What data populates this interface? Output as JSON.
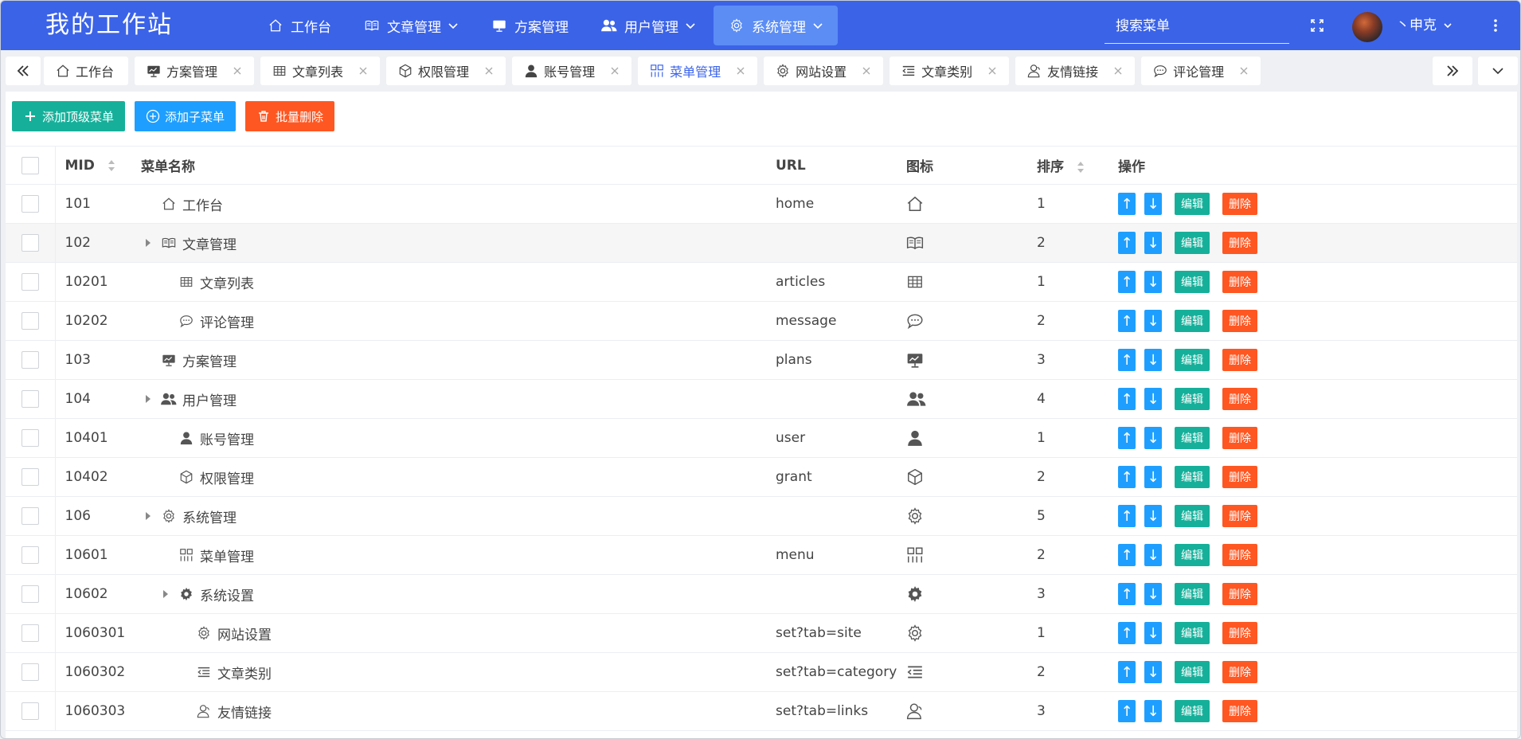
{
  "app": {
    "title": "我的工作站"
  },
  "nav": {
    "items": [
      {
        "label": "工作台",
        "icon": "home-icon",
        "dropdown": false
      },
      {
        "label": "文章管理",
        "icon": "book-icon",
        "dropdown": true
      },
      {
        "label": "方案管理",
        "icon": "presentation-icon",
        "dropdown": false
      },
      {
        "label": "用户管理",
        "icon": "users-icon",
        "dropdown": true
      },
      {
        "label": "系统管理",
        "icon": "gear-icon",
        "dropdown": true,
        "active": true
      }
    ]
  },
  "search": {
    "placeholder": "搜索菜单"
  },
  "user": {
    "name": "丶申克"
  },
  "tabs": [
    {
      "label": "工作台",
      "icon": "home-icon",
      "closable": false
    },
    {
      "label": "方案管理",
      "icon": "presentation-icon",
      "closable": true
    },
    {
      "label": "文章列表",
      "icon": "table-icon",
      "closable": true
    },
    {
      "label": "权限管理",
      "icon": "cube-icon",
      "closable": true
    },
    {
      "label": "账号管理",
      "icon": "user-icon",
      "closable": true
    },
    {
      "label": "菜单管理",
      "icon": "menu-grid-icon",
      "closable": true,
      "active": true
    },
    {
      "label": "网站设置",
      "icon": "gear-icon",
      "closable": true
    },
    {
      "label": "文章类别",
      "icon": "indent-icon",
      "closable": true
    },
    {
      "label": "友情链接",
      "icon": "user-outline-icon",
      "closable": true
    },
    {
      "label": "评论管理",
      "icon": "chat-icon",
      "closable": true
    }
  ],
  "toolbar": {
    "add_top_label": "添加顶级菜单",
    "add_child_label": "添加子菜单",
    "batch_delete_label": "批量删除"
  },
  "table": {
    "columns": {
      "mid": "MID",
      "name": "菜单名称",
      "url": "URL",
      "icon": "图标",
      "sort": "排序",
      "ops": "操作"
    },
    "op_labels": {
      "up": "↑",
      "down": "↓",
      "edit": "编辑",
      "delete": "删除"
    },
    "rows": [
      {
        "mid": "101",
        "name": "工作台",
        "url": "home",
        "icon": "home-icon",
        "sort": "1",
        "level": 0,
        "expandable": false
      },
      {
        "mid": "102",
        "name": "文章管理",
        "url": "",
        "icon": "book-icon",
        "sort": "2",
        "level": 0,
        "expandable": true
      },
      {
        "mid": "10201",
        "name": "文章列表",
        "url": "articles",
        "icon": "table-icon",
        "sort": "1",
        "level": 1,
        "expandable": false
      },
      {
        "mid": "10202",
        "name": "评论管理",
        "url": "message",
        "icon": "chat-icon",
        "sort": "2",
        "level": 1,
        "expandable": false
      },
      {
        "mid": "103",
        "name": "方案管理",
        "url": "plans",
        "icon": "presentation-icon",
        "sort": "3",
        "level": 0,
        "expandable": false
      },
      {
        "mid": "104",
        "name": "用户管理",
        "url": "",
        "icon": "users-icon",
        "sort": "4",
        "level": 0,
        "expandable": true
      },
      {
        "mid": "10401",
        "name": "账号管理",
        "url": "user",
        "icon": "user-icon",
        "sort": "1",
        "level": 1,
        "expandable": false
      },
      {
        "mid": "10402",
        "name": "权限管理",
        "url": "grant",
        "icon": "cube-icon",
        "sort": "2",
        "level": 1,
        "expandable": false
      },
      {
        "mid": "106",
        "name": "系统管理",
        "url": "",
        "icon": "gear-icon",
        "sort": "5",
        "level": 0,
        "expandable": true
      },
      {
        "mid": "10601",
        "name": "菜单管理",
        "url": "menu",
        "icon": "menu-grid-icon",
        "sort": "2",
        "level": 1,
        "expandable": false
      },
      {
        "mid": "10602",
        "name": "系统设置",
        "url": "",
        "icon": "cog-solid-icon",
        "sort": "3",
        "level": 1,
        "expandable": true
      },
      {
        "mid": "1060301",
        "name": "网站设置",
        "url": "set?tab=site",
        "icon": "gear-icon",
        "sort": "1",
        "level": 2,
        "expandable": false
      },
      {
        "mid": "1060302",
        "name": "文章类别",
        "url": "set?tab=category",
        "icon": "indent-icon",
        "sort": "2",
        "level": 2,
        "expandable": false
      },
      {
        "mid": "1060303",
        "name": "友情链接",
        "url": "set?tab=links",
        "icon": "user-outline-icon",
        "sort": "3",
        "level": 2,
        "expandable": false
      }
    ]
  },
  "colors": {
    "header": "#3b63e8",
    "nav_active": "#5b8df5",
    "tab_active": "#3b63e8",
    "green": "#16b09a",
    "blue": "#1e9fff",
    "orange": "#ff5722"
  }
}
